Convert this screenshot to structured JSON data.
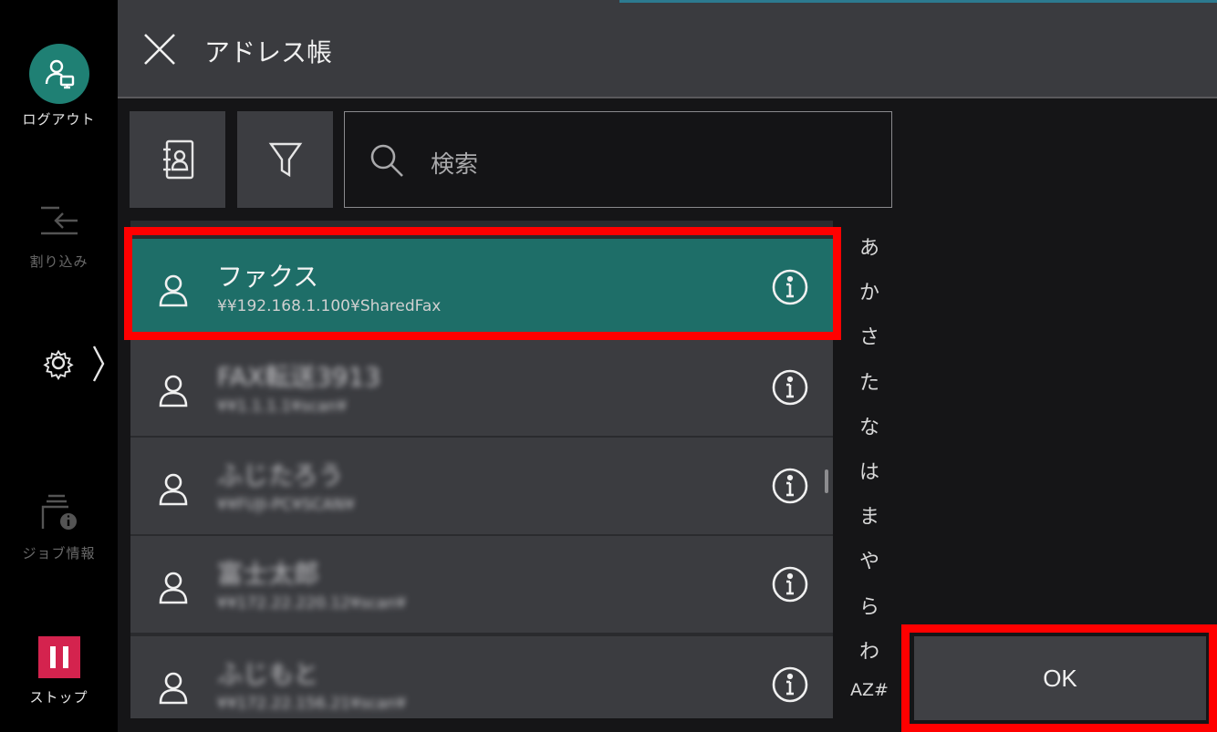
{
  "sidebar": {
    "logout_label": "ログアウト",
    "interrupt_label": "割り込み",
    "job_info_label": "ジョブ情報",
    "stop_label": "ストップ"
  },
  "header": {
    "title": "アドレス帳"
  },
  "search": {
    "placeholder": "検索"
  },
  "contacts": [
    {
      "name": "ファクス",
      "address": "¥¥192.168.1.100¥SharedFax"
    },
    {
      "name": "FAX転送3913",
      "address": "¥¥1.1.1.1¥scan¥"
    },
    {
      "name": "ふじたろう",
      "address": "¥¥FUJI-PC¥SCAN¥"
    },
    {
      "name": "富士太郎",
      "address": "¥¥172.22.220.12¥scan¥"
    },
    {
      "name": "ふじもと",
      "address": "¥¥172.22.156.21¥scan¥"
    }
  ],
  "index_letters": [
    "あ",
    "か",
    "さ",
    "た",
    "な",
    "は",
    "ま",
    "や",
    "ら",
    "わ",
    "AZ#"
  ],
  "ok_label": "OK",
  "colors": {
    "accent_teal": "#1e6e68",
    "stop_red": "#d4234e",
    "highlight_red": "#ff0000"
  },
  "icons": [
    "logout-icon",
    "interrupt-icon",
    "gear-icon",
    "chevron-right-icon",
    "job-info-icon",
    "stop-icon",
    "close-icon",
    "address-book-icon",
    "filter-icon",
    "search-icon",
    "person-icon",
    "info-icon"
  ]
}
